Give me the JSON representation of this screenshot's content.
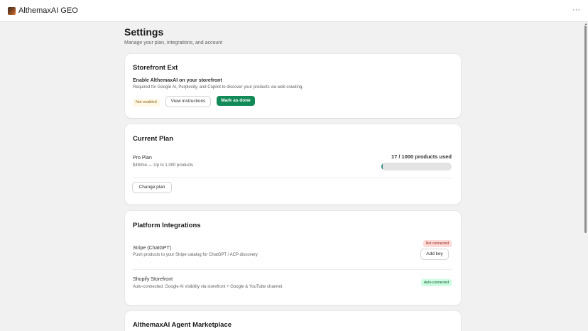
{
  "app": {
    "title": "AlthemaxAI GEO",
    "more_label": "···"
  },
  "page": {
    "title": "Settings",
    "subtitle": "Manage your plan, integrations, and account"
  },
  "storefront": {
    "title": "Storefront Ext",
    "heading": "Enable AlthemaxAI on your storefront",
    "description": "Required for Google AI, Perplexity, and Copilot to discover your products via web crawling.",
    "status_badge": "Not enabled",
    "instructions_button": "View instructions",
    "done_button": "Mark as done"
  },
  "plan": {
    "title": "Current Plan",
    "name": "Pro Plan",
    "price": "$49/mo — Up to 1,000 products",
    "usage_text": "17 / 1000 products used",
    "usage_used": 17,
    "usage_total": 1000,
    "change_button": "Change plan"
  },
  "integrations": {
    "title": "Platform Integrations",
    "items": [
      {
        "name": "Stripe (ChatGPT)",
        "description": "Push products to your Stripe catalog for ChatGPT / ACP discovery",
        "badge": "Not connected",
        "action": "Add key"
      },
      {
        "name": "Shopify Storefront",
        "description": "Auto-connected. Google AI visibility via storefront + Google & YouTube channel.",
        "badge": "Auto-connected"
      }
    ]
  },
  "marketplace": {
    "title": "AlthemaxAI Agent Marketplace"
  },
  "colors": {
    "primary": "#128a57",
    "progress": "#3b8b8b",
    "warning_bg": "#fff8e6",
    "critical_bg": "#fedad9",
    "success_bg": "#cdfee1"
  }
}
